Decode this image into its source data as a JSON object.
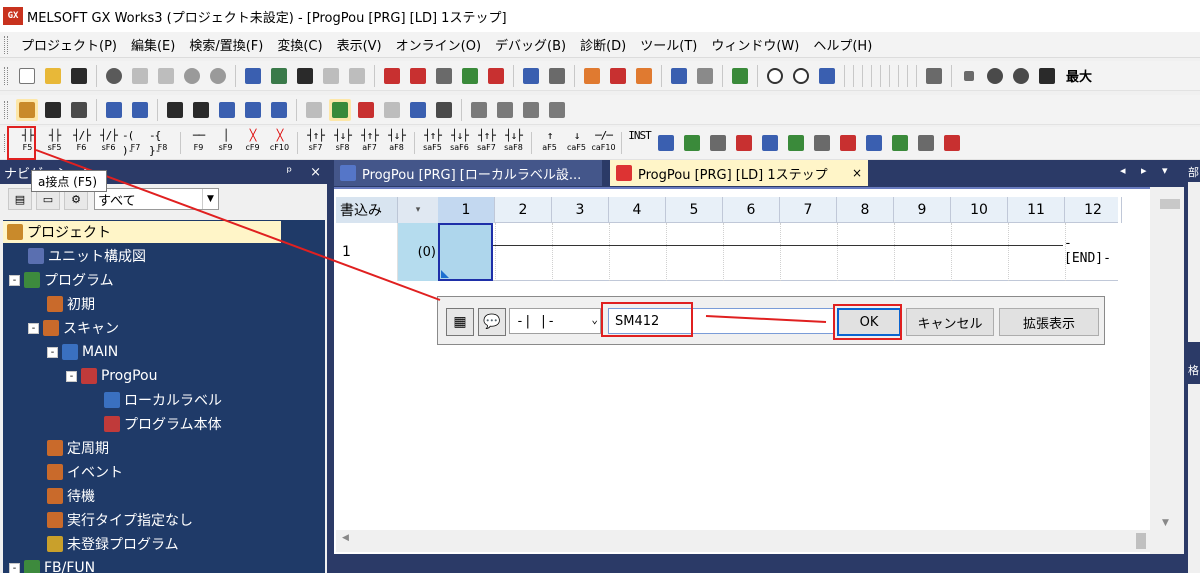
{
  "window": {
    "logo_text": "GX",
    "title": "MELSOFT GX Works3 (プロジェクト未設定) - [ProgPou [PRG] [LD] 1ステップ]"
  },
  "menu": [
    "プロジェクト(P)",
    "編集(E)",
    "検索/置換(F)",
    "変換(C)",
    "表示(V)",
    "オンライン(O)",
    "デバッグ(B)",
    "診断(D)",
    "ツール(T)",
    "ウィンドウ(W)",
    "ヘルプ(H)"
  ],
  "toolbar1": {
    "partial_text": "最大"
  },
  "fkeys": [
    {
      "sym": "┤├",
      "label": "F5"
    },
    {
      "sym": "┤├",
      "label": "sF5"
    },
    {
      "sym": "┤/├",
      "label": "F6"
    },
    {
      "sym": "┤/├",
      "label": "sF6"
    },
    {
      "sym": "-( )-",
      "label": "F7"
    },
    {
      "sym": "-{ }-",
      "label": "F8"
    },
    {
      "sym": "──",
      "label": "F9"
    },
    {
      "sym": "│",
      "label": "sF9"
    },
    {
      "sym": "╳",
      "label": "cF9",
      "red": true
    },
    {
      "sym": "╳",
      "label": "cF10",
      "red": true
    },
    {
      "sym": "┤↑├",
      "label": "sF7"
    },
    {
      "sym": "┤↓├",
      "label": "sF8"
    },
    {
      "sym": "┤↑├",
      "label": "aF7"
    },
    {
      "sym": "┤↓├",
      "label": "aF8"
    },
    {
      "sym": "┤↑├",
      "label": "saF5"
    },
    {
      "sym": "┤↓├",
      "label": "saF6"
    },
    {
      "sym": "┤↑├",
      "label": "saF7"
    },
    {
      "sym": "┤↓├",
      "label": "saF8"
    },
    {
      "sym": "↑",
      "label": "aF5"
    },
    {
      "sym": "↓",
      "label": "caF5"
    },
    {
      "sym": "─/─",
      "label": "caF10"
    },
    {
      "sym": "INST",
      "label": ""
    }
  ],
  "tooltip": "a接点 (F5)",
  "navigation": {
    "title": "ナビゲーション",
    "pin": "ᵖ",
    "close": "×",
    "filter_value": "すべて",
    "tree": [
      {
        "label": "プロジェクト",
        "level": 0,
        "expander": "",
        "color": "#c98a2b",
        "selected": true
      },
      {
        "label": "ユニット構成図",
        "level": 1,
        "expander": "",
        "color": "#5a6fb0"
      },
      {
        "label": "プログラム",
        "level": 0,
        "expander": "⊟",
        "color": "#3d8a3d"
      },
      {
        "label": "初期",
        "level": 2,
        "expander": "",
        "color": "#c96a2b"
      },
      {
        "label": "スキャン",
        "level": 1,
        "expander": "⊟",
        "color": "#c96a2b"
      },
      {
        "label": "MAIN",
        "level": 2,
        "expander": "⊟",
        "color": "#3a70c0"
      },
      {
        "label": "ProgPou",
        "level": 3,
        "expander": "⊟",
        "color": "#c03a3a"
      },
      {
        "label": "ローカルラベル",
        "level": 5,
        "expander": "",
        "color": "#3a70c0"
      },
      {
        "label": "プログラム本体",
        "level": 5,
        "expander": "",
        "color": "#c03a3a"
      },
      {
        "label": "定周期",
        "level": 2,
        "expander": "",
        "color": "#c96a2b"
      },
      {
        "label": "イベント",
        "level": 2,
        "expander": "",
        "color": "#c96a2b"
      },
      {
        "label": "待機",
        "level": 2,
        "expander": "",
        "color": "#c96a2b"
      },
      {
        "label": "実行タイプ指定なし",
        "level": 2,
        "expander": "",
        "color": "#c96a2b"
      },
      {
        "label": "未登録プログラム",
        "level": 2,
        "expander": "",
        "color": "#c9a02b"
      },
      {
        "label": "FB/FUN",
        "level": 0,
        "expander": "⊟",
        "color": "#3d8a3d"
      }
    ]
  },
  "tabs": [
    {
      "label": "ProgPou [PRG] [ローカルラベル設...",
      "active": false
    },
    {
      "label": "ProgPou [PRG] [LD] 1ステップ",
      "active": true,
      "close": "×"
    }
  ],
  "tab_controls": "◂ ▸ ▾",
  "ladder": {
    "mode_label": "書込み",
    "columns": [
      "1",
      "2",
      "3",
      "4",
      "5",
      "6",
      "7",
      "8",
      "9",
      "10",
      "11",
      "12"
    ],
    "rung_number": "1",
    "step": "(0)",
    "end_label": "-[END]-"
  },
  "dialog": {
    "instruction_symbol": "-| |-",
    "device_input": "SM412",
    "ok": "OK",
    "cancel": "キャンセル",
    "expand": "拡張表示"
  },
  "right_panel": {
    "label1": "部",
    "label2": "格"
  }
}
